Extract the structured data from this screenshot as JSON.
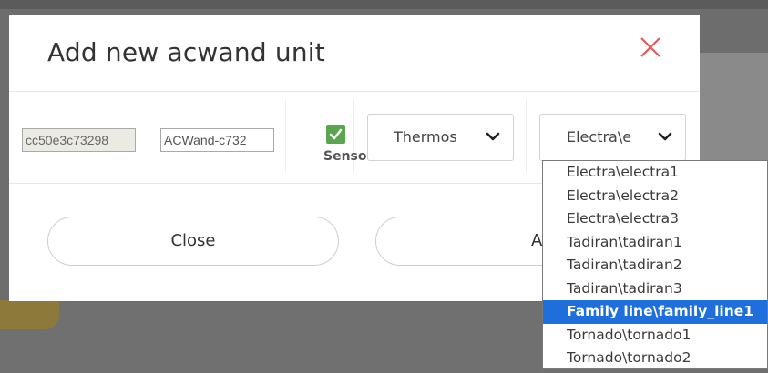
{
  "dialog": {
    "title": "Add new acwand unit",
    "mac_value": "cc50e3c73298",
    "name_value": "ACWand-c732",
    "sensor_label": "Sensor",
    "sensor_checked": true,
    "type_select": "Thermos",
    "model_select": "Electra\\e",
    "close_label": "Close",
    "add_label": "Add"
  },
  "model_options": [
    "Electra\\electra1",
    "Electra\\electra2",
    "Electra\\electra3",
    "Tadiran\\tadiran1",
    "Tadiran\\tadiran2",
    "Tadiran\\tadiran3",
    "Family line\\family_line1",
    "Tornado\\tornado1",
    "Tornado\\tornado2"
  ],
  "highlighted_option": "Family line\\family_line1",
  "colors": {
    "close_x": "#e05a5a",
    "checkbox": "#5aa64e",
    "highlight": "#1e6fdc"
  },
  "icons": [
    "close-icon",
    "check-icon",
    "chevron-down-icon"
  ]
}
